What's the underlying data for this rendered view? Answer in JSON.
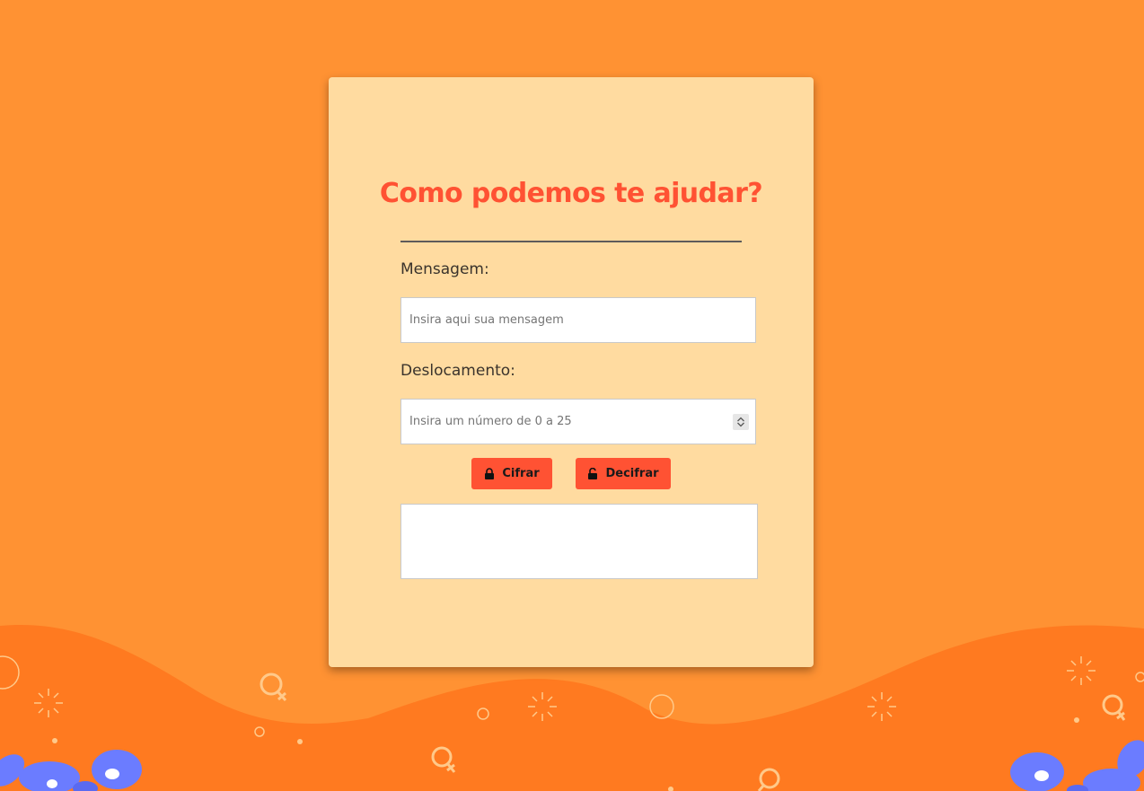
{
  "colors": {
    "background": "#ff9233",
    "wave": "#ff7a20",
    "card": "#ffdba0",
    "accent": "#ff5233",
    "decor": "#ffc98a",
    "flower": "#6b7cff"
  },
  "form": {
    "title": "Como podemos te ajudar?",
    "message_label": "Mensagem:",
    "message_placeholder": "Insira aqui sua mensagem",
    "message_value": "",
    "shift_label": "Deslocamento:",
    "shift_placeholder": "Insira um número de 0 a 25",
    "shift_value": "",
    "encrypt_button": "Cifrar",
    "encrypt_icon": "lock-icon",
    "decrypt_button": "Decifrar",
    "decrypt_icon": "unlock-icon",
    "output_value": ""
  }
}
